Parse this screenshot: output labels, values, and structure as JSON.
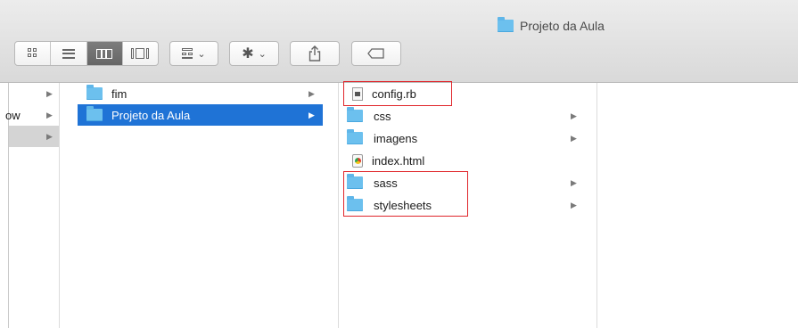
{
  "window": {
    "title": "Projeto da Aula"
  },
  "toolbar": {
    "view_modes": [
      "icon-view",
      "list-view",
      "column-view",
      "coverflow-view"
    ],
    "arrange_icon": "arrange-icon",
    "action_icon": "gear-icon",
    "share_icon": "share-icon",
    "tag_icon": "tag-icon"
  },
  "columns": {
    "col1": {
      "items": [
        {
          "label": "",
          "has_arrow": true
        },
        {
          "label": "ow",
          "has_arrow": true
        },
        {
          "label": "",
          "has_arrow": true,
          "selected": true
        }
      ]
    },
    "col2": {
      "items": [
        {
          "label": "fim",
          "type": "folder",
          "has_arrow": true
        },
        {
          "label": "Projeto da Aula",
          "type": "folder",
          "has_arrow": true,
          "selected": true
        }
      ]
    },
    "col3": {
      "items": [
        {
          "label": "config.rb",
          "type": "file-rb",
          "has_arrow": false
        },
        {
          "label": "css",
          "type": "folder",
          "has_arrow": true
        },
        {
          "label": "imagens",
          "type": "folder",
          "has_arrow": true
        },
        {
          "label": "index.html",
          "type": "file-html",
          "has_arrow": false
        },
        {
          "label": "sass",
          "type": "folder",
          "has_arrow": true
        },
        {
          "label": "stylesheets",
          "type": "folder",
          "has_arrow": true
        }
      ]
    }
  },
  "colors": {
    "selection": "#1f73d6",
    "folder": "#6cc0ee",
    "annotation": "#e0262b"
  }
}
